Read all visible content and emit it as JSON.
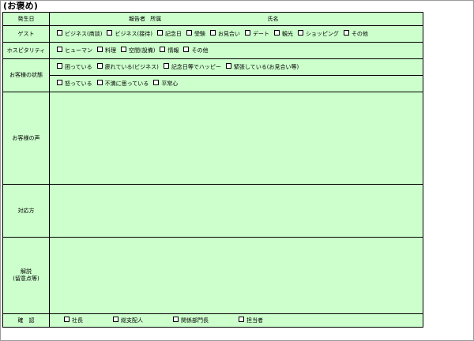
{
  "title": "(お褒め)",
  "header": {
    "occurrence_date_label": "発生日",
    "reporter_label": "報告者",
    "department_label": "所属",
    "name_label": "氏名"
  },
  "guest": {
    "label": "ゲスト",
    "options": [
      "ビジネス(商談)",
      "ビジネス(接待)",
      "記念日",
      "受験",
      "お見合い",
      "デート",
      "観光",
      "ショッピング",
      "その他"
    ]
  },
  "hospitality": {
    "label": "ホスピタリティ",
    "options": [
      "ヒューマン",
      "料理",
      "空間(設備)",
      "情報",
      "その他"
    ]
  },
  "customer_state": {
    "label": "お客様の状態",
    "options_row1": [
      "困っている",
      "疲れている(ビジネス)",
      "記念日等でハッピー",
      "緊張している(お見合い等)"
    ],
    "options_row2": [
      "怒っている",
      "不満に思っている",
      "平常心"
    ]
  },
  "customer_voice": {
    "label": "お客様の声"
  },
  "response": {
    "label": "対応方"
  },
  "explanation": {
    "label_line1": "解説",
    "label_line2": "(留意点等)"
  },
  "confirmation": {
    "label": "確　認",
    "options": [
      "社長",
      "総支配人",
      "関係部門長",
      "担当者"
    ]
  }
}
